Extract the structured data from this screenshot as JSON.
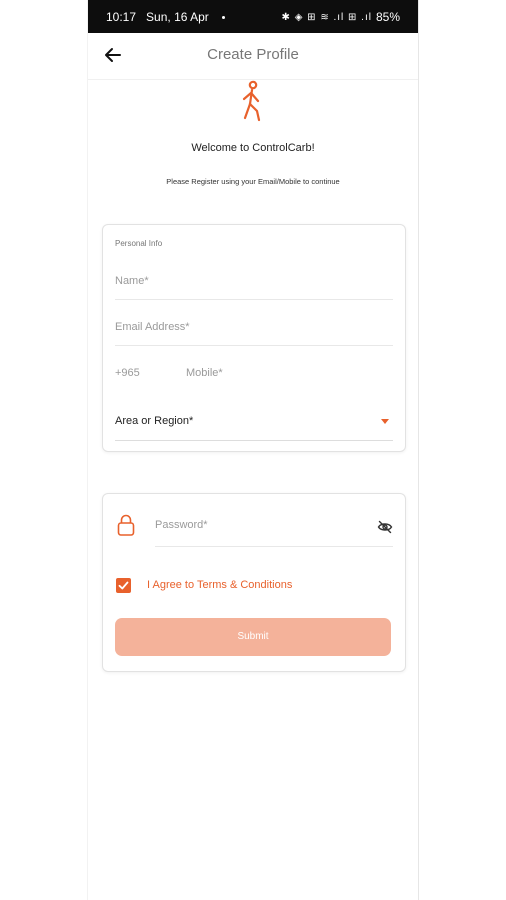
{
  "status_bar": {
    "time": "10:17",
    "date": "Sun, 16 Apr",
    "icons": "✱ ◈ ⊞ ≋ .ıl ⊞ .ıl",
    "battery": "85%"
  },
  "header": {
    "title": "Create Profile"
  },
  "intro": {
    "welcome": "Welcome to ControlCarb!",
    "subtitle": "Please Register using your Email/Mobile to continue"
  },
  "personal_info": {
    "section_label": "Personal Info",
    "name_placeholder": "Name*",
    "email_placeholder": "Email Address*",
    "country_code": "+965",
    "mobile_placeholder": "Mobile*",
    "area_value": "Area or Region*"
  },
  "security": {
    "password_placeholder": "Password*",
    "terms_label": "I Agree to Terms & Conditions",
    "terms_checked": true,
    "submit_label": "Submit"
  },
  "colors": {
    "accent": "#e8612c",
    "submit_disabled": "#f4b29a",
    "status_bar": "#0d0d0d"
  }
}
